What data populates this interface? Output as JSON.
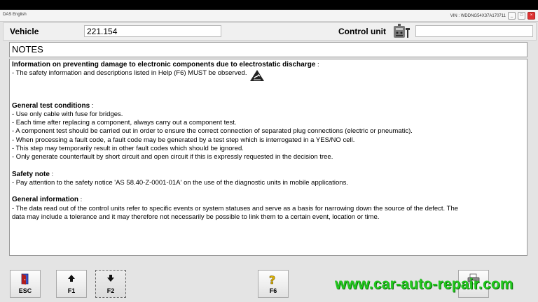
{
  "window": {
    "title": "DAS English",
    "vin": "VIN : WDDNG54X37A170711",
    "minimize": "_",
    "maximize": "□",
    "close": "×"
  },
  "header": {
    "vehicle_label": "Vehicle",
    "vehicle_value": "221.154",
    "control_unit_label": "Control unit",
    "control_unit_value": ""
  },
  "notes_title": "NOTES",
  "sections": {
    "esd": {
      "heading": "Information on preventing damage to electronic components due to electrostatic discharge",
      "suffix": " :",
      "line": "- The safety information and descriptions listed in Help (F6) MUST be observed."
    },
    "general": {
      "heading": "General test conditions",
      "suffix": " :",
      "lines": [
        "- Use only cable with fuse for bridges.",
        "- Each time after replacing a component, always carry out a component test.",
        "- A component test should be carried out in order to ensure the correct connection of separated plug connections (electric or pneumatic).",
        "- When processing a fault code, a fault code may be generated by a test step which is interrogated in a YES/NO cell.",
        "- This step may temporarily result in other fault codes which should be ignored.",
        "- Only generate counterfault by short circuit and open circuit if this is expressly requested in the decision tree."
      ]
    },
    "safety": {
      "heading": "Safety note",
      "suffix": " :",
      "line": "- Pay attention to the safety notice 'AS 58.40-Z-0001-01A' on the use of the diagnostic units in mobile applications."
    },
    "info": {
      "heading": "General information",
      "suffix": " :",
      "lines": [
        "- The data read out of the control units refer to specific events or system statuses and serve as a basis for narrowing down the source of the defect. The",
        "  data may include a tolerance and it may therefore not necessarily be possible to link them to a certain event, location or time."
      ]
    }
  },
  "footer": {
    "esc": "ESC",
    "f1": "F1",
    "f2": "F2",
    "f6": "F6",
    "print": ""
  },
  "watermark": "www.car-auto-repair.com"
}
